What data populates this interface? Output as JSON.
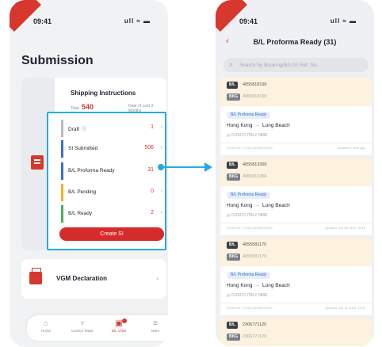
{
  "left_screen": {
    "status_time": "09:41",
    "status_icons": "ull ≈ ▬",
    "title": "Submission",
    "si_card": {
      "title": "Shipping Instructions",
      "total_label": "Total",
      "total_value": "540",
      "date_label": "Date of Last 3 Months",
      "rows": [
        {
          "label": "Draft",
          "count": "1",
          "color": "#b5bac3"
        },
        {
          "label": "SI Submitted",
          "count": "506",
          "color": "#3d6fd0"
        },
        {
          "label": "B/L Proforma Ready",
          "count": "31",
          "color": "#3d6fd0"
        },
        {
          "label": "B/L Pending",
          "count": "0",
          "color": "#f0b429"
        },
        {
          "label": "B/L Ready",
          "count": "2",
          "color": "#4bb24e"
        }
      ],
      "create_button": "Create SI"
    },
    "vgm_label": "VGM Declaration",
    "tabs": [
      {
        "label": "Home",
        "icon": "home-icon",
        "glyph": "⌂"
      },
      {
        "label": "Control Tower",
        "icon": "tower-icon",
        "glyph": "♆"
      },
      {
        "label": "B/L VGM",
        "icon": "document-icon",
        "glyph": "▣"
      },
      {
        "label": "More",
        "icon": "menu-icon",
        "glyph": "≡"
      }
    ]
  },
  "right_screen": {
    "status_time": "09:41",
    "status_icons": "ull ≈ ▬",
    "back_glyph": "‹",
    "nav_title": "B/L Proforma Ready (31)",
    "search_placeholder": "Search by Booking/B/L/SI Ref. Nu...",
    "cards": [
      {
        "bl": "4055818190",
        "bkg": "4055818190",
        "status": "B/L Proforma Ready",
        "origin": "Hong Kong",
        "dest": "Long Beach",
        "carrier": "COSCO ITALY 080E",
        "ref": "SI Ref No.: COSCO2024070413",
        "updated": "Updated 3 mins ago"
      },
      {
        "bl": "4055813360",
        "bkg": "4055813360",
        "status": "B/L Proforma Ready",
        "origin": "Hong Kong",
        "dest": "Long Beach",
        "carrier": "COSCO ITALY 080E",
        "ref": "SI Ref No.: COSCO2024070415",
        "updated": "Updated: Apr 28 2024, 16:18"
      },
      {
        "bl": "4055581170",
        "bkg": "4055581170",
        "status": "B/L Proforma Ready",
        "origin": "Hong Kong",
        "dest": "Long Beach",
        "carrier": "COSCO ITALY 080E",
        "ref": "SI Ref No.: COSCO2024070416",
        "updated": "Updated: Apr 21 2024, 11:20"
      },
      {
        "bl": "2306771120",
        "bkg": "2306771120"
      }
    ]
  },
  "tags": {
    "bl": "B/L",
    "bkg": "BKG"
  },
  "colors": {
    "brand_red": "#d8372e",
    "callout_blue": "#27a9e1",
    "proforma_bg": "#fcf2de"
  }
}
